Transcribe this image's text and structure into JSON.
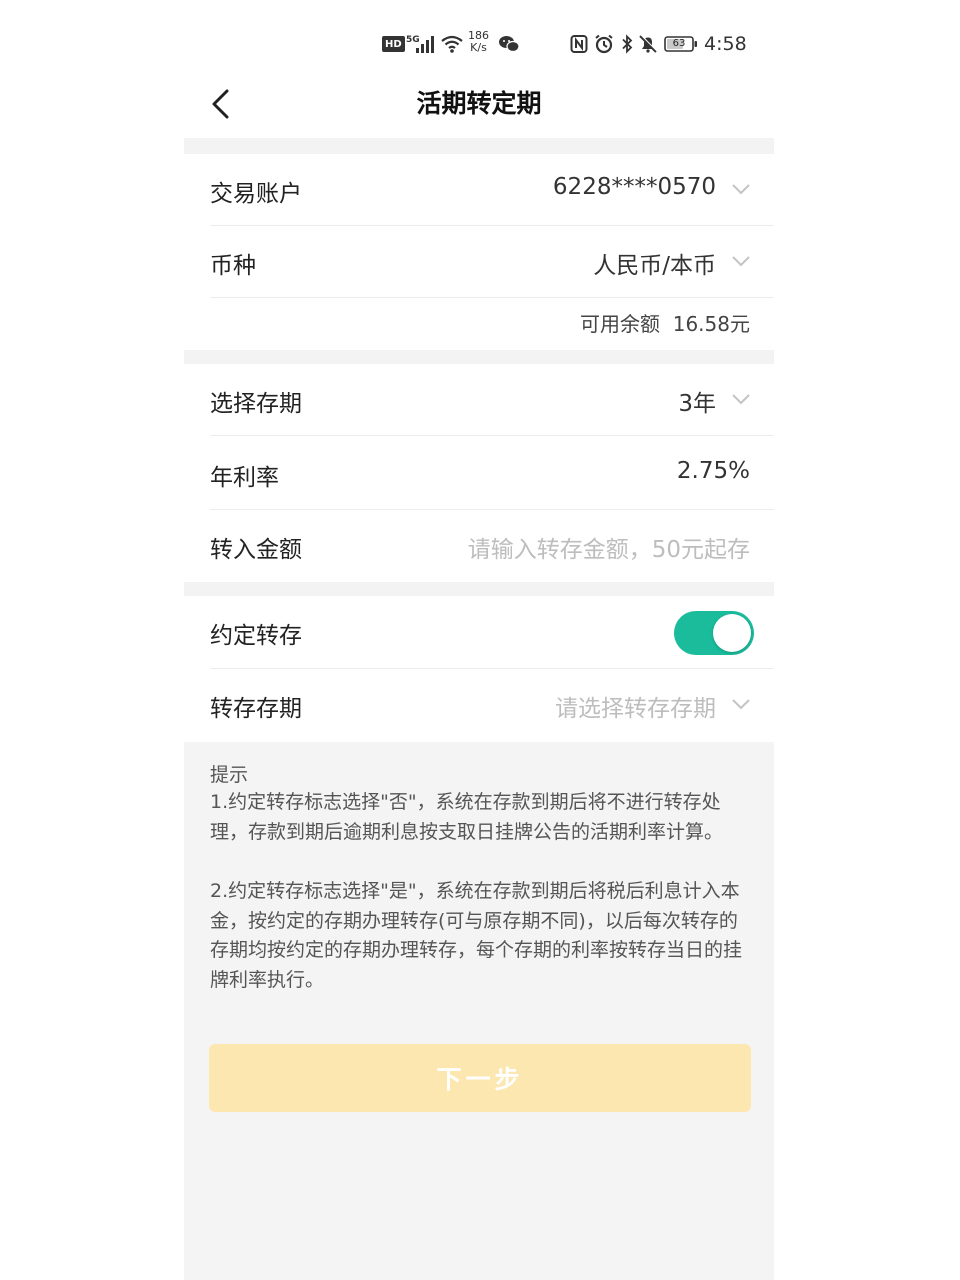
{
  "status_bar": {
    "hd": "HD",
    "network": "5G",
    "speed_value": "186",
    "speed_unit": "K/s",
    "battery": "63",
    "time": "4:58"
  },
  "header": {
    "title": "活期转定期"
  },
  "account": {
    "label": "交易账户",
    "value": "6228****0570"
  },
  "currency": {
    "label": "币种",
    "value": "人民币/本币"
  },
  "balance": {
    "label": "可用余额",
    "value": "16.58元"
  },
  "term": {
    "label": "选择存期",
    "value": "3年"
  },
  "rate": {
    "label": "年利率",
    "value": "2.75%"
  },
  "amount": {
    "label": "转入金额",
    "placeholder": "请输入转存金额，50元起存"
  },
  "auto_renew": {
    "label": "约定转存",
    "enabled": true
  },
  "renew_term": {
    "label": "转存存期",
    "placeholder": "请选择转存存期"
  },
  "tips": {
    "title": "提示",
    "p1": "1.约定转存标志选择\"否\"，系统在存款到期后将不进行转存处理，存款到期后逾期利息按支取日挂牌公告的活期利率计算。",
    "p2": "2.约定转存标志选择\"是\"，系统在存款到期后将税后利息计入本金，按约定的存期办理转存(可与原存期不同)，以后每次转存的存期均按约定的存期办理转存，每个存期的利率按转存当日的挂牌利率执行。"
  },
  "next_button": {
    "label": "下一步"
  },
  "colors": {
    "toggle_on": "#1abc9c",
    "button_disabled": "#fde7b0",
    "section_gap": "#f3f3f3"
  }
}
